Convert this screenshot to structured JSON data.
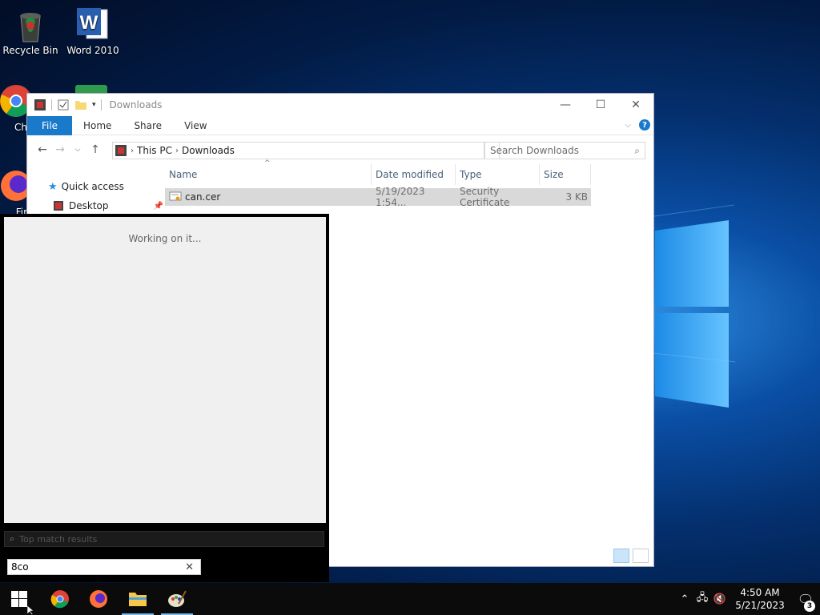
{
  "desktop": {
    "icons": [
      {
        "label": "Recycle Bin"
      },
      {
        "label": "Word 2010"
      },
      {
        "label": "Ch"
      },
      {
        "label": "Fir"
      }
    ]
  },
  "explorer": {
    "title": "Downloads",
    "ribbon": {
      "file_tab": "File",
      "tabs": [
        "Home",
        "Share",
        "View"
      ]
    },
    "breadcrumb": [
      "This PC",
      "Downloads"
    ],
    "search_placeholder": "Search Downloads",
    "sidebar": {
      "quick_access": "Quick access",
      "items": [
        {
          "label": "Desktop"
        }
      ]
    },
    "columns": [
      "Name",
      "Date modified",
      "Type",
      "Size"
    ],
    "files": [
      {
        "name": "can.cer",
        "date": "5/19/2023 1:54...",
        "type": "Security Certificate",
        "size": "3 KB"
      }
    ]
  },
  "search_panel": {
    "status": "Working on it...",
    "dark_placeholder": "Top match results",
    "query": "8co"
  },
  "taskbar": {
    "time": "4:50 AM",
    "date": "5/21/2023",
    "notification_count": "3"
  },
  "colors": {
    "accent": "#1979ca",
    "selection": "#d9d9d9",
    "taskbar": "#0b0b0b"
  }
}
